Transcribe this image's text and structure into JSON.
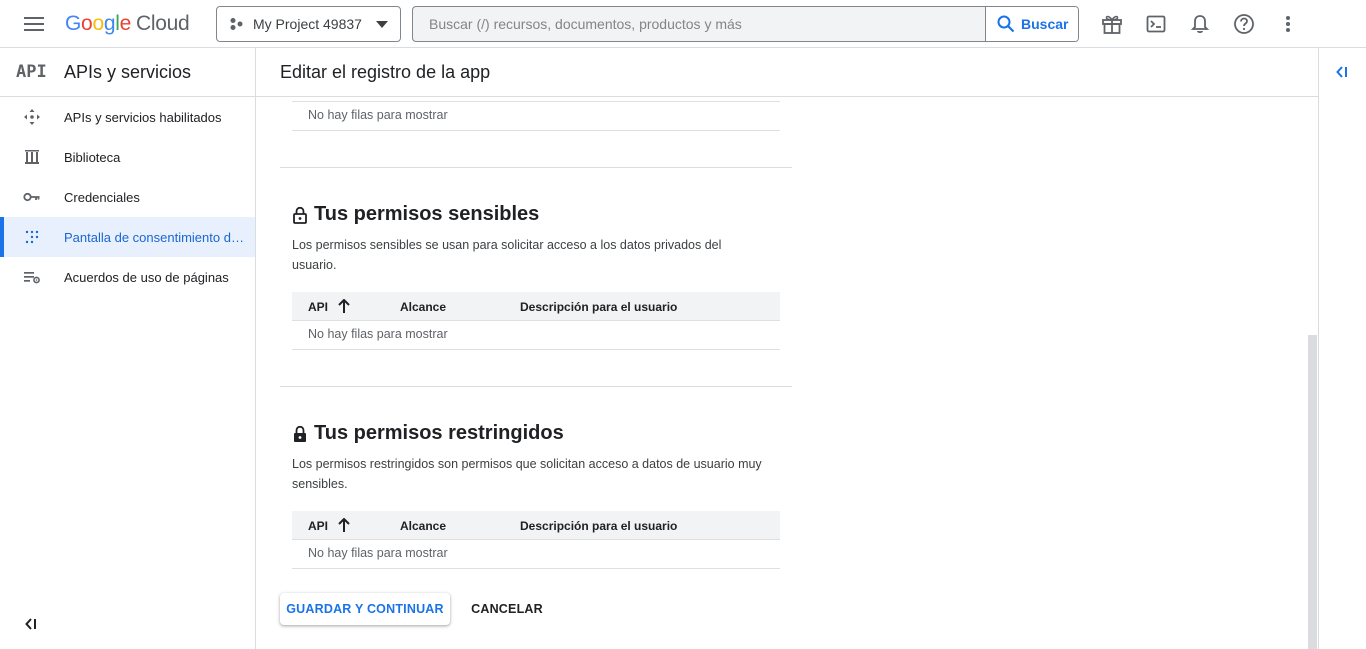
{
  "header": {
    "logo_google": "Google",
    "logo_cloud": "Cloud",
    "project": "My Project 49837",
    "search_placeholder": "Buscar (/) recursos, documentos, productos y más",
    "search_button": "Buscar"
  },
  "sidebar": {
    "api_badge": "API",
    "title": "APIs y servicios",
    "items": [
      {
        "label": "APIs y servicios habilitados",
        "icon": "enabled-apis-icon"
      },
      {
        "label": "Biblioteca",
        "icon": "library-icon"
      },
      {
        "label": "Credenciales",
        "icon": "key-icon"
      },
      {
        "label": "Pantalla de consentimiento de OAuth",
        "icon": "consent-screen-icon",
        "active": true
      },
      {
        "label": "Acuerdos de uso de páginas",
        "icon": "page-usage-icon"
      }
    ]
  },
  "main": {
    "page_title": "Editar el registro de la app",
    "table_empty": "No hay filas para mostrar",
    "sensitive": {
      "title": "Tus permisos sensibles",
      "description": "Los permisos sensibles se usan para solicitar acceso a los datos privados del usuario."
    },
    "restricted": {
      "title": "Tus permisos restringidos",
      "description": "Los permisos restringidos son permisos que solicitan acceso a datos de usuario muy sensibles."
    },
    "columns": {
      "api": "API",
      "scope": "Alcance",
      "user_description": "Descripción para el usuario"
    },
    "buttons": {
      "save": "GUARDAR Y CONTINUAR",
      "cancel": "CANCELAR"
    }
  },
  "colors": {
    "accent": "#1a73e8",
    "active_bg": "#e8f0fe",
    "border": "#dadce0"
  }
}
